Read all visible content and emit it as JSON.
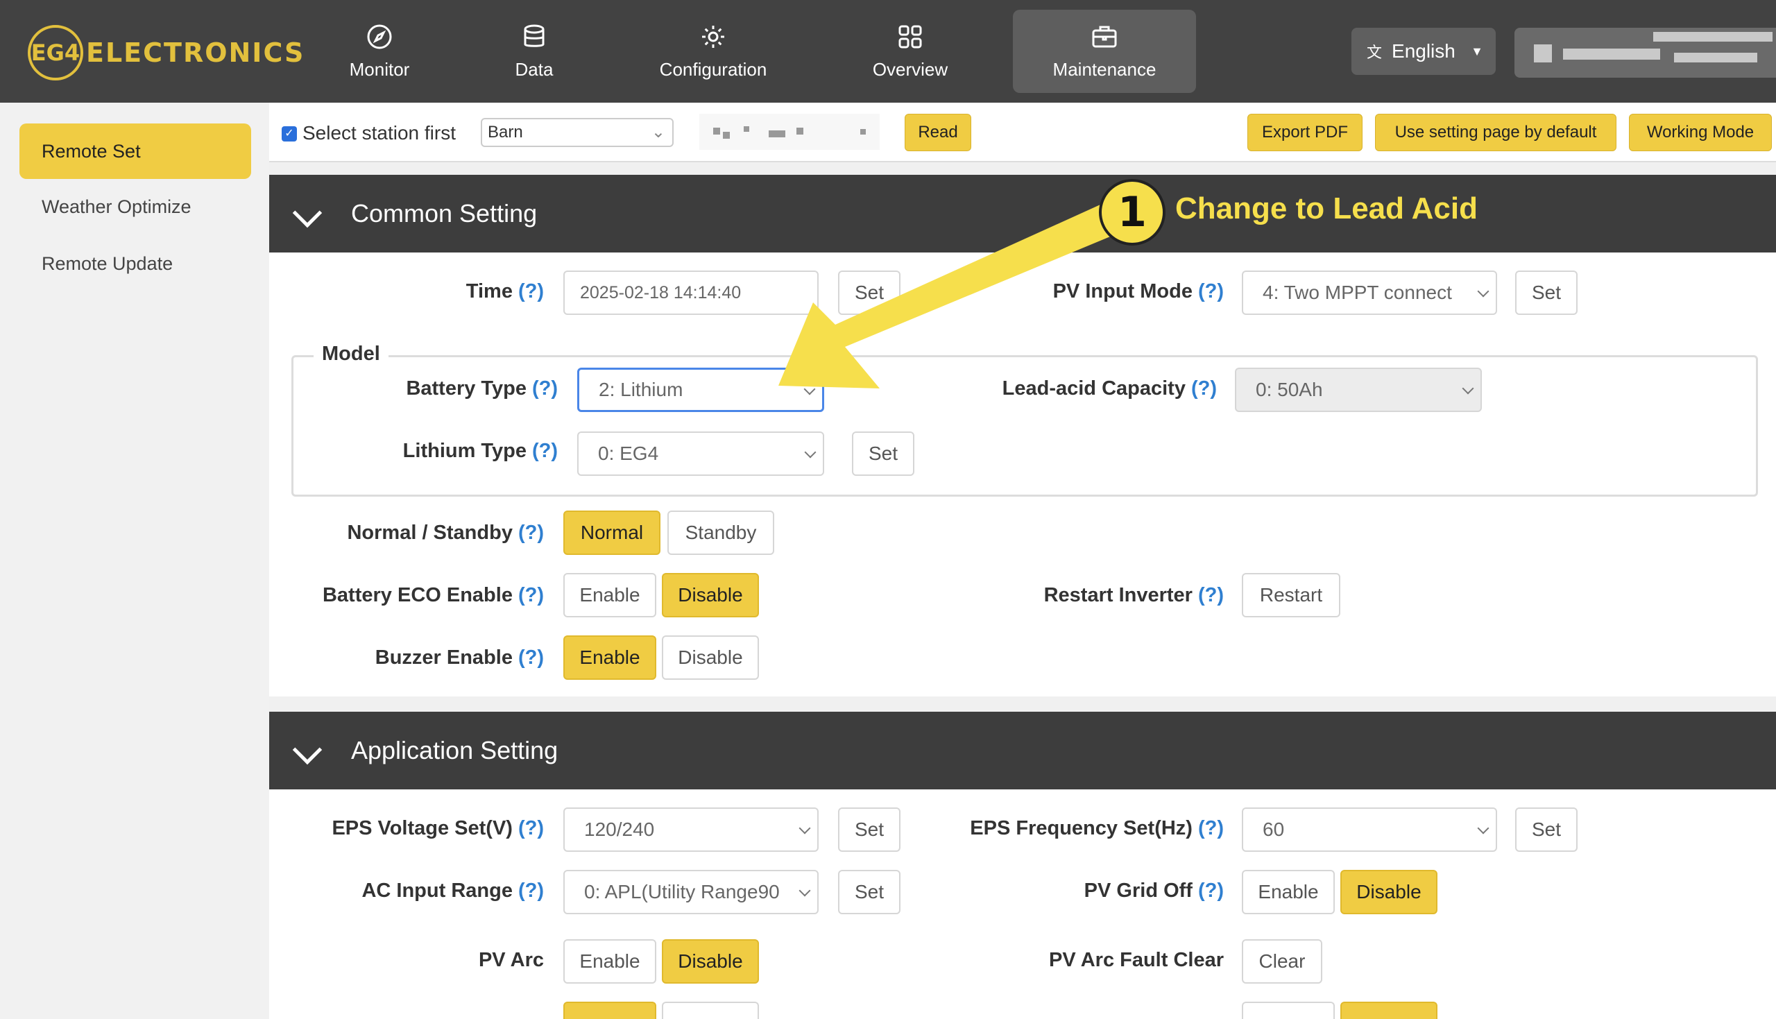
{
  "header": {
    "logo_badge": "EG4",
    "logo_text": "ELECTRONICS",
    "nav": [
      "Monitor",
      "Data",
      "Configuration",
      "Overview",
      "Maintenance"
    ],
    "active_nav": "Maintenance",
    "language": "English"
  },
  "sidebar": {
    "items": [
      "Remote Set",
      "Weather Optimize",
      "Remote Update"
    ],
    "active": "Remote Set"
  },
  "toolbar": {
    "select_station_label": "Select station first",
    "select_station_checked": true,
    "station": "Barn",
    "read": "Read",
    "export_pdf": "Export PDF",
    "use_setting_page": "Use setting page by default",
    "working_mode": "Working Mode"
  },
  "annotation": {
    "number": "1",
    "text": "Change to Lead Acid",
    "color": "#f6df4c"
  },
  "help": "(?)",
  "common": {
    "title": "Common Setting",
    "time_label": "Time",
    "time_value": "2025-02-18 14:14:40",
    "set": "Set",
    "pv_input_mode_label": "PV Input Mode",
    "pv_input_mode_value": "4: Two MPPT connect",
    "model_legend": "Model",
    "battery_type_label": "Battery Type",
    "battery_type_value": "2: Lithium",
    "lead_acid_capacity_label": "Lead-acid Capacity",
    "lead_acid_capacity_value": "0: 50Ah",
    "lithium_type_label": "Lithium Type",
    "lithium_type_value": "0: EG4",
    "normal_standby_label": "Normal / Standby",
    "normal": "Normal",
    "standby": "Standby",
    "battery_eco_label": "Battery ECO Enable",
    "enable": "Enable",
    "disable": "Disable",
    "restart_inverter_label": "Restart Inverter",
    "restart": "Restart",
    "buzzer_label": "Buzzer Enable"
  },
  "application": {
    "title": "Application Setting",
    "eps_voltage_label": "EPS Voltage Set(V)",
    "eps_voltage_value": "120/240",
    "eps_freq_label": "EPS Frequency Set(Hz)",
    "eps_freq_value": "60",
    "ac_input_label": "AC Input Range",
    "ac_input_value": "0: APL(Utility Range90",
    "pv_grid_off_label": "PV Grid Off",
    "pv_arc_label": "PV Arc",
    "pv_arc_fault_label": "PV Arc Fault Clear",
    "clear": "Clear"
  },
  "colors": {
    "accent": "#f0cc43",
    "header_bg": "#424242",
    "section_bg": "#3d3d3d",
    "help_blue": "#2f7fd0"
  }
}
